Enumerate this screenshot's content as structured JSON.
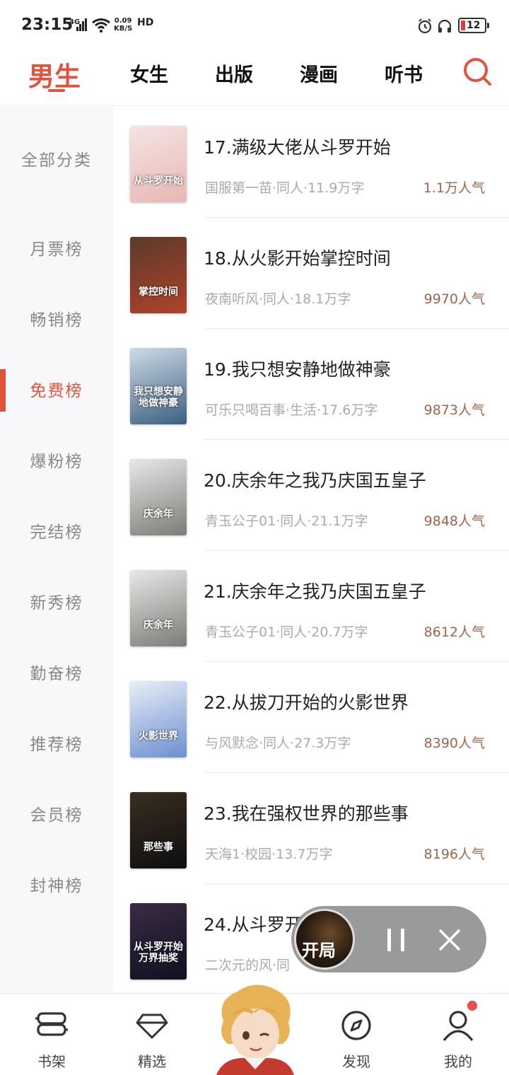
{
  "status_bar": {
    "time": "23:15",
    "network": "4G",
    "speed_value": "0.09",
    "speed_unit": "KB/S",
    "hd": "HD",
    "battery": "12"
  },
  "top_tabs": [
    {
      "label": "男生",
      "active": true
    },
    {
      "label": "女生",
      "active": false
    },
    {
      "label": "出版",
      "active": false
    },
    {
      "label": "漫画",
      "active": false
    },
    {
      "label": "听书",
      "active": false
    }
  ],
  "search_icon": "search-icon",
  "sidebar": [
    {
      "label": "全部分类"
    },
    {
      "label": "月票榜"
    },
    {
      "label": "畅销榜"
    },
    {
      "label": "免费榜",
      "active": true
    },
    {
      "label": "爆粉榜"
    },
    {
      "label": "完结榜"
    },
    {
      "label": "新秀榜"
    },
    {
      "label": "勤奋榜"
    },
    {
      "label": "推荐榜"
    },
    {
      "label": "会员榜"
    },
    {
      "label": "封神榜"
    }
  ],
  "books": [
    {
      "title": "17.满级大佬从斗罗开始",
      "meta": "国服第一苗·同人·11.9万字",
      "count": "1.1万人气",
      "cover_text": "从斗罗开始",
      "cover_colors": [
        "#f4e4e2",
        "#e8b7b4"
      ]
    },
    {
      "title": "18.从火影开始掌控时间",
      "meta": "夜南听风·同人·18.1万字",
      "count": "9970人气",
      "cover_text": "掌控时间",
      "cover_colors": [
        "#5a3a2a",
        "#b0432a"
      ]
    },
    {
      "title": "19.我只想安静地做神豪",
      "meta": "可乐只喝百事·生活·17.6万字",
      "count": "9873人气",
      "cover_text": "我只想安静地做神豪",
      "cover_colors": [
        "#cfdbe6",
        "#3b5f80"
      ]
    },
    {
      "title": "20.庆余年之我乃庆国五皇子",
      "meta": "青玉公子01·同人·21.1万字",
      "count": "9848人气",
      "cover_text": "庆余年",
      "cover_colors": [
        "#e8e8e6",
        "#7b7b78"
      ]
    },
    {
      "title": "21.庆余年之我乃庆国五皇子",
      "meta": "青玉公子01·同人·20.7万字",
      "count": "8612人气",
      "cover_text": "庆余年",
      "cover_colors": [
        "#e8e8e6",
        "#7b7b78"
      ]
    },
    {
      "title": "22.从拔刀开始的火影世界",
      "meta": "与风默念·同人·27.3万字",
      "count": "8390人气",
      "cover_text": "火影世界",
      "cover_colors": [
        "#e9eef6",
        "#6c8fd0"
      ]
    },
    {
      "title": "23.我在强权世界的那些事",
      "meta": "天海1·校园·13.7万字",
      "count": "8196人气",
      "cover_text": "那些事",
      "cover_colors": [
        "#3a2e20",
        "#0e0e10"
      ]
    },
    {
      "title": "24.从斗罗开",
      "meta": "二次元的风·同",
      "count": "",
      "cover_text": "从斗罗开始万界抽奖",
      "cover_colors": [
        "#3b2b44",
        "#101020"
      ]
    }
  ],
  "player": {
    "cover_text": "开局",
    "pause_icon": "pause-icon",
    "close_icon": "close-icon"
  },
  "bottom_nav": [
    {
      "label": "书架",
      "icon": "bookshelf-icon"
    },
    {
      "label": "精选",
      "icon": "diamond-icon"
    },
    {
      "label": "发现",
      "icon": "compass-icon"
    },
    {
      "label": "我的",
      "icon": "user-icon",
      "badge": true
    }
  ]
}
